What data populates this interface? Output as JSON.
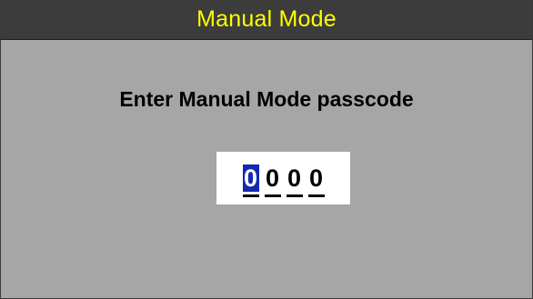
{
  "header": {
    "title": "Manual Mode"
  },
  "main": {
    "prompt": "Enter Manual Mode passcode",
    "passcode": {
      "digits": [
        "0",
        "0",
        "0",
        "0"
      ],
      "active_index": 0
    }
  },
  "colors": {
    "title_bar": "#3c3c3c",
    "title_text": "#ffff00",
    "background": "#a6a6a6",
    "code_box": "#ffffff",
    "active_digit": "#1428b4"
  }
}
